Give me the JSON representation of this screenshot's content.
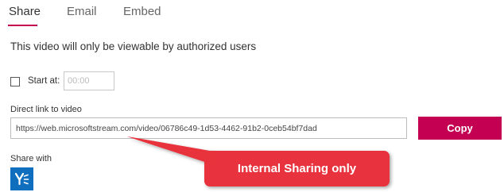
{
  "tabs": [
    {
      "label": "Share"
    },
    {
      "label": "Email"
    },
    {
      "label": "Embed"
    }
  ],
  "active_tab": "Share",
  "notice": "This video will only be viewable by authorized users",
  "start_at": {
    "label": "Start at:",
    "placeholder": "00:00",
    "checked": false
  },
  "direct_link": {
    "label": "Direct link to video",
    "url": "https://web.microsoftstream.com/video/06786c49-1d53-4462-91b2-0ceb54bf7dad"
  },
  "copy_button": {
    "label": "Copy"
  },
  "share_with": {
    "label": "Share with",
    "services": [
      {
        "icon": "yammer-icon"
      }
    ]
  },
  "callout": {
    "text": "Internal Sharing only"
  },
  "colors": {
    "accent": "#c30052",
    "yammer": "#106ebe",
    "callout": "#e8323c"
  }
}
